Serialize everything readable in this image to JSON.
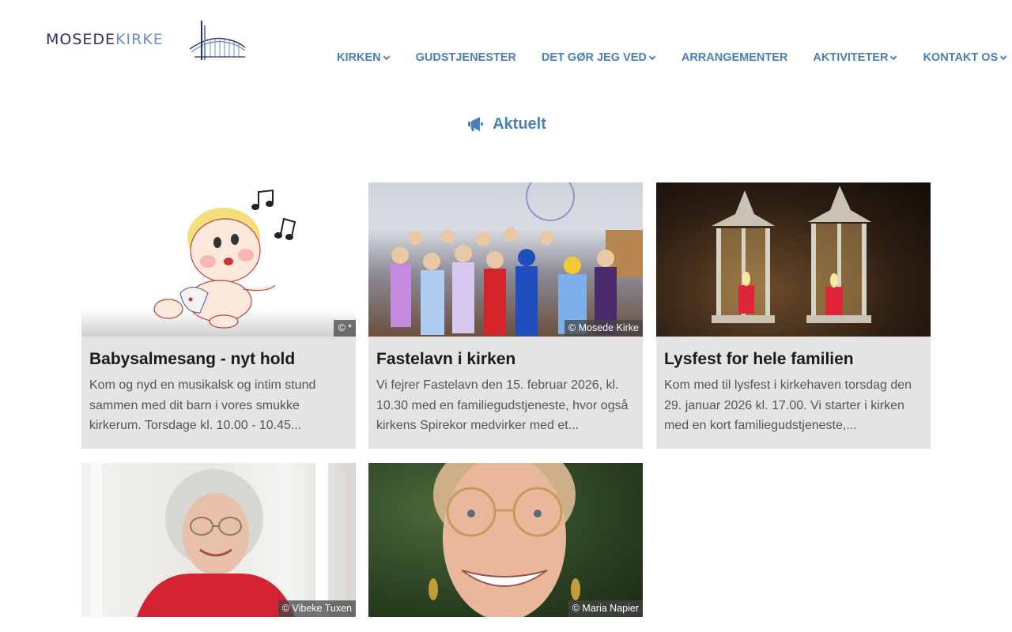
{
  "header": {
    "logo_text_part1": "MOSEDE",
    "logo_text_part2": "KIRKE"
  },
  "nav": {
    "items": [
      {
        "label": "KIRKEN",
        "has_dropdown": true
      },
      {
        "label": "GUDSTJENESTER",
        "has_dropdown": false
      },
      {
        "label": "DET GØR JEG VED",
        "has_dropdown": true
      },
      {
        "label": "ARRANGEMENTER",
        "has_dropdown": false
      },
      {
        "label": "AKTIVITETER",
        "has_dropdown": true
      },
      {
        "label": "KONTAKT OS",
        "has_dropdown": true
      }
    ]
  },
  "section": {
    "title": "Aktuelt",
    "icon": "megaphone-icon"
  },
  "cards": [
    {
      "title": "Babysalmesang - nyt hold",
      "excerpt": "Kom og nyd en musikalsk og intim stund sammen med dit barn i vores smukke kirkerum. Torsdage kl. 10.00 - 10.45...",
      "credit": "© *"
    },
    {
      "title": "Fastelavn i kirken",
      "excerpt": "Vi fejrer Fastelavn den 15. februar 2026, kl. 10.30 med en familiegudstjeneste, hvor også kirkens Spirekor medvirker med et...",
      "credit": "© Mosede Kirke"
    },
    {
      "title": "Lysfest for hele familien",
      "excerpt": "Kom med til lysfest i kirkehaven torsdag den 29. januar 2026 kl. 17.00. Vi starter i kirken med en kort familiegudstjeneste,...",
      "credit": ""
    },
    {
      "title": "",
      "excerpt": "",
      "credit": "© Vibeke Tuxen"
    },
    {
      "title": "",
      "excerpt": "",
      "credit": "© Maria Napier"
    }
  ],
  "colors": {
    "nav": "#4a7fb8",
    "card_bg": "#e4e4e4",
    "logo_dark": "#2c2f6b",
    "logo_light": "#6a8fc8"
  }
}
